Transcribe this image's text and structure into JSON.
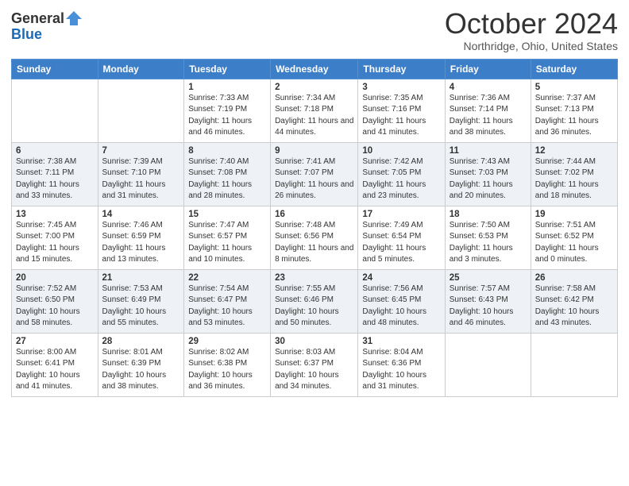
{
  "header": {
    "logo_general": "General",
    "logo_blue": "Blue",
    "month_title": "October 2024",
    "location": "Northridge, Ohio, United States"
  },
  "days_of_week": [
    "Sunday",
    "Monday",
    "Tuesday",
    "Wednesday",
    "Thursday",
    "Friday",
    "Saturday"
  ],
  "weeks": [
    [
      {
        "day": "",
        "sunrise": "",
        "sunset": "",
        "daylight": ""
      },
      {
        "day": "",
        "sunrise": "",
        "sunset": "",
        "daylight": ""
      },
      {
        "day": "1",
        "sunrise": "Sunrise: 7:33 AM",
        "sunset": "Sunset: 7:19 PM",
        "daylight": "Daylight: 11 hours and 46 minutes."
      },
      {
        "day": "2",
        "sunrise": "Sunrise: 7:34 AM",
        "sunset": "Sunset: 7:18 PM",
        "daylight": "Daylight: 11 hours and 44 minutes."
      },
      {
        "day": "3",
        "sunrise": "Sunrise: 7:35 AM",
        "sunset": "Sunset: 7:16 PM",
        "daylight": "Daylight: 11 hours and 41 minutes."
      },
      {
        "day": "4",
        "sunrise": "Sunrise: 7:36 AM",
        "sunset": "Sunset: 7:14 PM",
        "daylight": "Daylight: 11 hours and 38 minutes."
      },
      {
        "day": "5",
        "sunrise": "Sunrise: 7:37 AM",
        "sunset": "Sunset: 7:13 PM",
        "daylight": "Daylight: 11 hours and 36 minutes."
      }
    ],
    [
      {
        "day": "6",
        "sunrise": "Sunrise: 7:38 AM",
        "sunset": "Sunset: 7:11 PM",
        "daylight": "Daylight: 11 hours and 33 minutes."
      },
      {
        "day": "7",
        "sunrise": "Sunrise: 7:39 AM",
        "sunset": "Sunset: 7:10 PM",
        "daylight": "Daylight: 11 hours and 31 minutes."
      },
      {
        "day": "8",
        "sunrise": "Sunrise: 7:40 AM",
        "sunset": "Sunset: 7:08 PM",
        "daylight": "Daylight: 11 hours and 28 minutes."
      },
      {
        "day": "9",
        "sunrise": "Sunrise: 7:41 AM",
        "sunset": "Sunset: 7:07 PM",
        "daylight": "Daylight: 11 hours and 26 minutes."
      },
      {
        "day": "10",
        "sunrise": "Sunrise: 7:42 AM",
        "sunset": "Sunset: 7:05 PM",
        "daylight": "Daylight: 11 hours and 23 minutes."
      },
      {
        "day": "11",
        "sunrise": "Sunrise: 7:43 AM",
        "sunset": "Sunset: 7:03 PM",
        "daylight": "Daylight: 11 hours and 20 minutes."
      },
      {
        "day": "12",
        "sunrise": "Sunrise: 7:44 AM",
        "sunset": "Sunset: 7:02 PM",
        "daylight": "Daylight: 11 hours and 18 minutes."
      }
    ],
    [
      {
        "day": "13",
        "sunrise": "Sunrise: 7:45 AM",
        "sunset": "Sunset: 7:00 PM",
        "daylight": "Daylight: 11 hours and 15 minutes."
      },
      {
        "day": "14",
        "sunrise": "Sunrise: 7:46 AM",
        "sunset": "Sunset: 6:59 PM",
        "daylight": "Daylight: 11 hours and 13 minutes."
      },
      {
        "day": "15",
        "sunrise": "Sunrise: 7:47 AM",
        "sunset": "Sunset: 6:57 PM",
        "daylight": "Daylight: 11 hours and 10 minutes."
      },
      {
        "day": "16",
        "sunrise": "Sunrise: 7:48 AM",
        "sunset": "Sunset: 6:56 PM",
        "daylight": "Daylight: 11 hours and 8 minutes."
      },
      {
        "day": "17",
        "sunrise": "Sunrise: 7:49 AM",
        "sunset": "Sunset: 6:54 PM",
        "daylight": "Daylight: 11 hours and 5 minutes."
      },
      {
        "day": "18",
        "sunrise": "Sunrise: 7:50 AM",
        "sunset": "Sunset: 6:53 PM",
        "daylight": "Daylight: 11 hours and 3 minutes."
      },
      {
        "day": "19",
        "sunrise": "Sunrise: 7:51 AM",
        "sunset": "Sunset: 6:52 PM",
        "daylight": "Daylight: 11 hours and 0 minutes."
      }
    ],
    [
      {
        "day": "20",
        "sunrise": "Sunrise: 7:52 AM",
        "sunset": "Sunset: 6:50 PM",
        "daylight": "Daylight: 10 hours and 58 minutes."
      },
      {
        "day": "21",
        "sunrise": "Sunrise: 7:53 AM",
        "sunset": "Sunset: 6:49 PM",
        "daylight": "Daylight: 10 hours and 55 minutes."
      },
      {
        "day": "22",
        "sunrise": "Sunrise: 7:54 AM",
        "sunset": "Sunset: 6:47 PM",
        "daylight": "Daylight: 10 hours and 53 minutes."
      },
      {
        "day": "23",
        "sunrise": "Sunrise: 7:55 AM",
        "sunset": "Sunset: 6:46 PM",
        "daylight": "Daylight: 10 hours and 50 minutes."
      },
      {
        "day": "24",
        "sunrise": "Sunrise: 7:56 AM",
        "sunset": "Sunset: 6:45 PM",
        "daylight": "Daylight: 10 hours and 48 minutes."
      },
      {
        "day": "25",
        "sunrise": "Sunrise: 7:57 AM",
        "sunset": "Sunset: 6:43 PM",
        "daylight": "Daylight: 10 hours and 46 minutes."
      },
      {
        "day": "26",
        "sunrise": "Sunrise: 7:58 AM",
        "sunset": "Sunset: 6:42 PM",
        "daylight": "Daylight: 10 hours and 43 minutes."
      }
    ],
    [
      {
        "day": "27",
        "sunrise": "Sunrise: 8:00 AM",
        "sunset": "Sunset: 6:41 PM",
        "daylight": "Daylight: 10 hours and 41 minutes."
      },
      {
        "day": "28",
        "sunrise": "Sunrise: 8:01 AM",
        "sunset": "Sunset: 6:39 PM",
        "daylight": "Daylight: 10 hours and 38 minutes."
      },
      {
        "day": "29",
        "sunrise": "Sunrise: 8:02 AM",
        "sunset": "Sunset: 6:38 PM",
        "daylight": "Daylight: 10 hours and 36 minutes."
      },
      {
        "day": "30",
        "sunrise": "Sunrise: 8:03 AM",
        "sunset": "Sunset: 6:37 PM",
        "daylight": "Daylight: 10 hours and 34 minutes."
      },
      {
        "day": "31",
        "sunrise": "Sunrise: 8:04 AM",
        "sunset": "Sunset: 6:36 PM",
        "daylight": "Daylight: 10 hours and 31 minutes."
      },
      {
        "day": "",
        "sunrise": "",
        "sunset": "",
        "daylight": ""
      },
      {
        "day": "",
        "sunrise": "",
        "sunset": "",
        "daylight": ""
      }
    ]
  ]
}
